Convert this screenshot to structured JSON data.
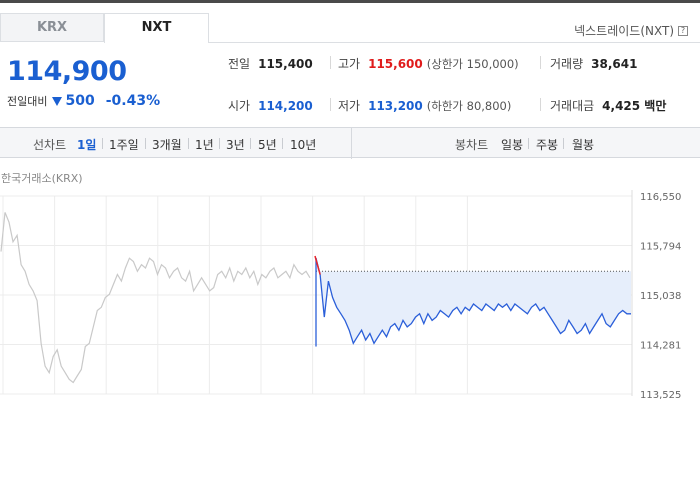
{
  "tabs": [
    {
      "label": "KRX",
      "active": false
    },
    {
      "label": "NXT",
      "active": true
    }
  ],
  "nxt_link": {
    "label": "넥스트레이드(NXT)",
    "help_icon": "help-icon"
  },
  "quote": {
    "price": "114,900",
    "change_label": "전일대비",
    "change_direction": "down",
    "change_value": "500",
    "change_percent": "-0.43%"
  },
  "stats": {
    "prev_close": {
      "label": "전일",
      "value": "115,400"
    },
    "high": {
      "label": "고가",
      "value": "115,600",
      "limit_text": "(상한가 150,000)"
    },
    "volume": {
      "label": "거래량",
      "value": "38,641"
    },
    "open": {
      "label": "시가",
      "value": "114,200"
    },
    "low": {
      "label": "저가",
      "value": "113,200",
      "limit_text": "(하한가 80,800)"
    },
    "turnover": {
      "label": "거래대금",
      "value": "4,425 백만"
    }
  },
  "toolbar": {
    "line_title": "선차트",
    "line_periods": [
      {
        "label": "1일",
        "active": true
      },
      {
        "label": "1주일",
        "active": false
      },
      {
        "label": "3개월",
        "active": false
      },
      {
        "label": "1년",
        "active": false
      },
      {
        "label": "3년",
        "active": false
      },
      {
        "label": "5년",
        "active": false
      },
      {
        "label": "10년",
        "active": false
      }
    ],
    "candle_title": "봉차트",
    "candle_periods": [
      {
        "label": "일봉"
      },
      {
        "label": "주봉"
      },
      {
        "label": "월봉"
      }
    ]
  },
  "chart": {
    "exchange_label": "한국거래소(KRX)",
    "colors": {
      "krx_line": "#c9c9c9",
      "nxt_line": "#2b5fd9",
      "fill": "#e6eefb",
      "first_tick": "#e8242b",
      "grid": "#ececec"
    },
    "y_ticks": [
      "116,550",
      "115,794",
      "115,038",
      "114,281",
      "113,525"
    ]
  },
  "chart_data": {
    "type": "line",
    "ylim": [
      113525,
      116550
    ],
    "reference_price": 115400,
    "series": [
      {
        "values": [
          115700,
          116300,
          116150,
          115850,
          115950,
          115500,
          115400,
          115200,
          115100,
          114950,
          114300,
          113950,
          113850,
          114100,
          114200,
          113950,
          113850,
          113750,
          113700,
          113800,
          113900,
          114250,
          114300,
          114550,
          114800,
          114850,
          115000,
          115050,
          115200,
          115350,
          115250,
          115450,
          115600,
          115550,
          115400,
          115500,
          115450,
          115600,
          115550,
          115350,
          115500,
          115450,
          115300,
          115400,
          115450,
          115300,
          115250,
          115400,
          115100,
          115200,
          115300,
          115200,
          115100,
          115150,
          115350,
          115400,
          115300,
          115450,
          115250,
          115400,
          115350,
          115450,
          115300,
          115400,
          115200,
          115350,
          115300,
          115400,
          115450,
          115300,
          115350,
          115400,
          115300,
          115500,
          115400,
          115350,
          115400,
          115300
        ]
      },
      {
        "values": [
          115600,
          115350,
          114700,
          115250,
          115000,
          114850,
          114750,
          114650,
          114500,
          114300,
          114400,
          114500,
          114350,
          114450,
          114300,
          114400,
          114500,
          114400,
          114550,
          114600,
          114500,
          114650,
          114550,
          114600,
          114700,
          114750,
          114600,
          114750,
          114650,
          114700,
          114800,
          114750,
          114700,
          114800,
          114850,
          114750,
          114850,
          114800,
          114900,
          114850,
          114800,
          114900,
          114850,
          114800,
          114900,
          114850,
          114900,
          114800,
          114900,
          114850,
          114800,
          114750,
          114850,
          114900,
          114800,
          114850,
          114750,
          114650,
          114550,
          114450,
          114500,
          114650,
          114550,
          114450,
          114500,
          114600,
          114450,
          114550,
          114650,
          114750,
          114600,
          114550,
          114650,
          114750,
          114800,
          114750,
          114750
        ]
      }
    ]
  }
}
